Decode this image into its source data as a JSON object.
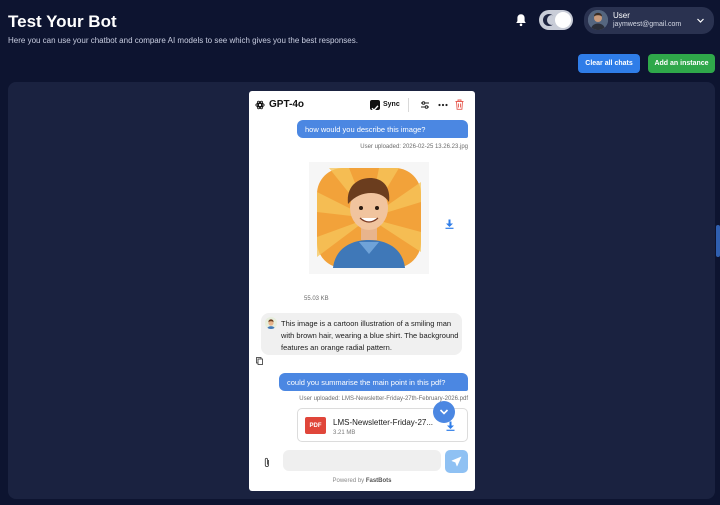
{
  "header": {
    "title": "Test Your Bot",
    "subtitle": "Here you can use your chatbot and compare AI models to see which gives you the best responses."
  },
  "user": {
    "name": "User",
    "email": "jaymwest@gmail.com"
  },
  "actions": {
    "clear_label": "Clear all chats",
    "add_label": "Add an instance"
  },
  "instance": {
    "model": "GPT-4o",
    "sync_label": "Sync",
    "sync_checked": true
  },
  "messages": {
    "q1": "how would you describe this image?",
    "q1_meta": "User uploaded: 2026-02-25 13.26.23.jpg",
    "image_size": "55.03 KB",
    "a1": "This image is a cartoon illustration of a smiling man with brown hair, wearing a blue shirt. The background features an orange radial pattern.",
    "q2": "could you summarise the main point in this pdf?",
    "q2_meta": "User uploaded: LMS-Newsletter-Friday-27th-February-2026.pdf",
    "file_type": "PDF",
    "file_name": "LMS-Newsletter-Friday-27...",
    "file_size": "3.21 MB"
  },
  "composer": {
    "placeholder": "",
    "powered_prefix": "Powered by ",
    "powered_brand": "FastBots"
  },
  "colors": {
    "page_bg": "#0d1430",
    "workspace_bg": "#1a2240",
    "accent_blue": "#2f7de8",
    "accent_green": "#2fa84a",
    "user_bubble": "#4b87e2",
    "pdf_red": "#e0463a"
  },
  "icons": [
    "bell-icon",
    "moon-icon",
    "chevron-down-icon",
    "openai-icon",
    "sliders-icon",
    "more-icon",
    "trash-icon",
    "download-icon",
    "copy-icon",
    "arrow-down-icon",
    "paperclip-icon",
    "send-icon"
  ]
}
